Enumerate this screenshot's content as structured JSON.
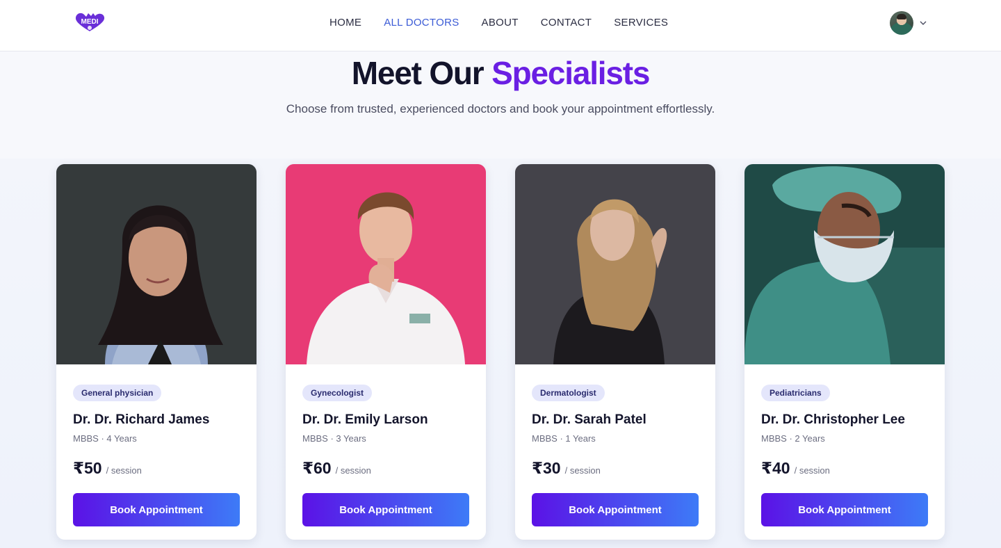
{
  "header": {
    "nav": [
      {
        "label": "HOME",
        "active": false
      },
      {
        "label": "ALL DOCTORS",
        "active": true
      },
      {
        "label": "ABOUT",
        "active": false
      },
      {
        "label": "CONTACT",
        "active": false
      },
      {
        "label": "SERVICES",
        "active": false
      }
    ],
    "icons": {
      "logo": "medi-logo",
      "profile": "user-avatar",
      "dropdown": "chevron-down-icon"
    }
  },
  "hero": {
    "title_main": "Meet Our",
    "title_accent": "Specialists",
    "subtitle": "Choose from trusted, experienced doctors and book your appointment effortlessly."
  },
  "doctors": [
    {
      "specialty": "General physician",
      "name": "Dr. Dr. Richard James",
      "meta": "MBBS · 4 Years",
      "fee": "₹50",
      "fee_unit": "/ session",
      "button": "Book Appointment"
    },
    {
      "specialty": "Gynecologist",
      "name": "Dr. Dr. Emily Larson",
      "meta": "MBBS · 3 Years",
      "fee": "₹60",
      "fee_unit": "/ session",
      "button": "Book Appointment"
    },
    {
      "specialty": "Dermatologist",
      "name": "Dr. Dr. Sarah Patel",
      "meta": "MBBS · 1 Years",
      "fee": "₹30",
      "fee_unit": "/ session",
      "button": "Book Appointment"
    },
    {
      "specialty": "Pediatricians",
      "name": "Dr. Dr. Christopher Lee",
      "meta": "MBBS · 2 Years",
      "fee": "₹40",
      "fee_unit": "/ session",
      "button": "Book Appointment"
    }
  ],
  "colors": {
    "accent": "#6a1fe3",
    "nav_active": "#3b5bd6",
    "button_start": "#5b12e6",
    "button_end": "#3d7bf7",
    "badge_bg": "#e4e6fb"
  }
}
